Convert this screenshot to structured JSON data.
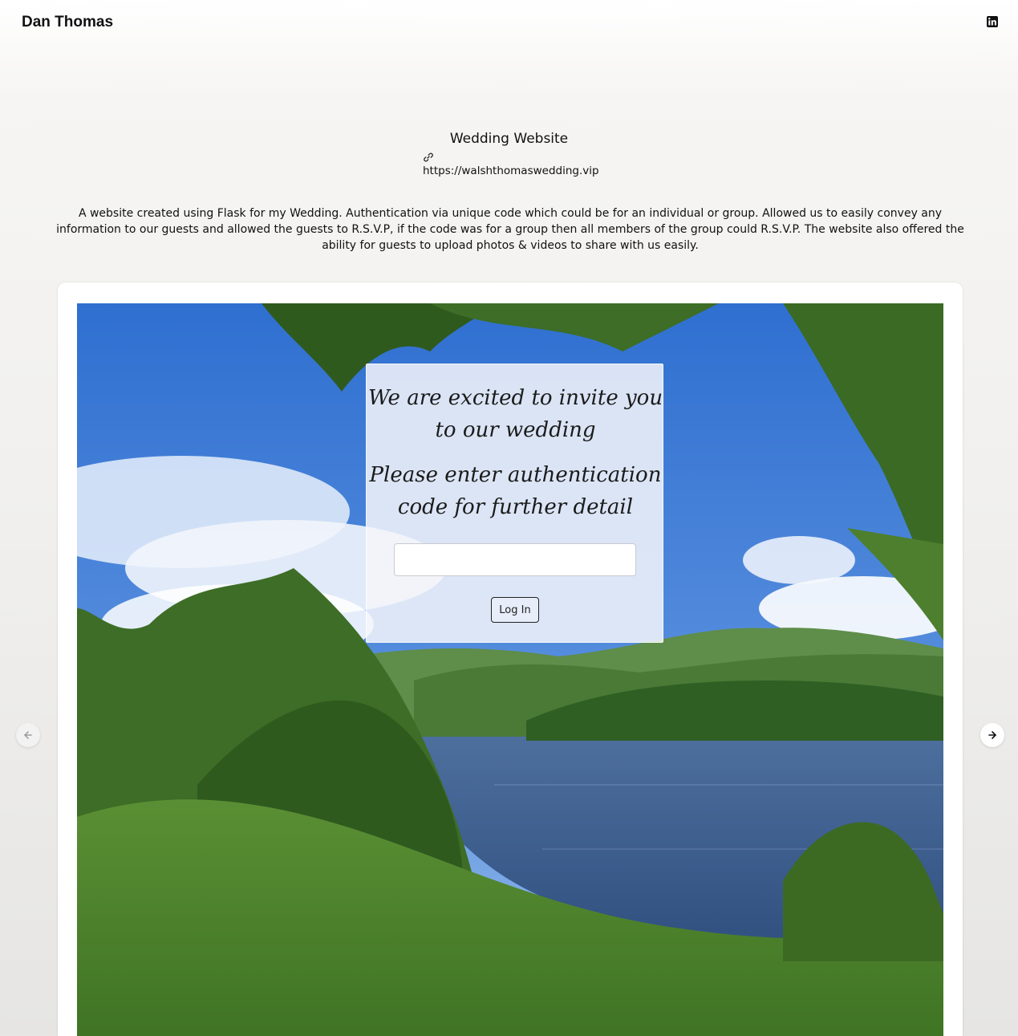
{
  "header": {
    "brand": "Dan Thomas",
    "linkedin_icon": "linkedin-icon"
  },
  "project": {
    "title": "Wedding Website",
    "link_icon": "link-icon",
    "url": "https://walshthomaswedding.vip",
    "description": "A website created using Flask for my Wedding. Authentication via unique code which could be for an individual or group. Allowed us to easily convey any information to our guests and allowed the guests to R.S.V.P, if the code was for a group then all members of the group could R.S.V.P. The website also offered the ability for guests to upload photos & videos to share with us easily."
  },
  "screenshot": {
    "heading_invite": "We are excited to invite you to our wedding",
    "heading_auth": "Please enter authentication code for further detail",
    "code_input_value": "",
    "login_button": "Log In"
  },
  "carousel": {
    "prev_icon": "arrow-left-icon",
    "next_icon": "arrow-right-icon"
  },
  "colors": {
    "sky": "#3f7ad6",
    "lake": "#3c5f92",
    "foliage": "#4f8a2f"
  }
}
